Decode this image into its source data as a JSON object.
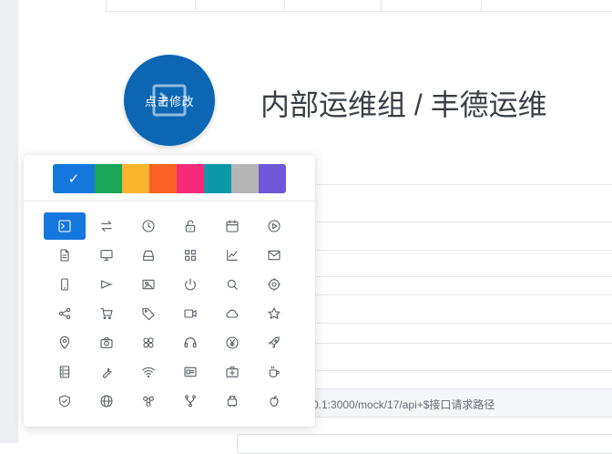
{
  "header": {
    "title": "内部运维组 / 丰德运维"
  },
  "avatar": {
    "hint": "点击修改",
    "icon": "terminal-icon",
    "color": "#0c66b3"
  },
  "form": {
    "api_path_value": "0.1:3000/mock/17/api+$接口请求路径"
  },
  "icon_picker": {
    "selected_color": "#1477de",
    "selected_check": "✓",
    "colors": [
      "#1477de",
      "#1aa557",
      "#fbb42e",
      "#f96222",
      "#f52b79",
      "#0e99a8",
      "#b5b5b5",
      "#6e58d8"
    ],
    "selected_icon": "terminal-icon",
    "icons": [
      [
        "terminal-icon",
        "swap-icon",
        "clock-icon",
        "unlock-icon",
        "calendar-icon",
        "play-circle-icon"
      ],
      [
        "file-text-icon",
        "monitor-icon",
        "hard-drive-icon",
        "apps-icon",
        "line-chart-icon",
        "mail-icon"
      ],
      [
        "mobile-icon",
        "megaphone-icon",
        "image-icon",
        "power-icon",
        "search-icon",
        "settings-icon"
      ],
      [
        "share-icon",
        "cart-icon",
        "tag-icon",
        "video-icon",
        "cloud-icon",
        "star-icon"
      ],
      [
        "location-icon",
        "camera-icon",
        "flower-icon",
        "headset-icon",
        "yen-icon",
        "rocket-icon"
      ],
      [
        "server-icon",
        "wrench-icon",
        "wifi-icon",
        "id-card-icon",
        "first-aid-icon",
        "coffee-icon"
      ],
      [
        "shield-check-icon",
        "globe-icon",
        "molecule-icon",
        "git-branch-icon",
        "android-icon",
        "apple-icon"
      ]
    ]
  }
}
